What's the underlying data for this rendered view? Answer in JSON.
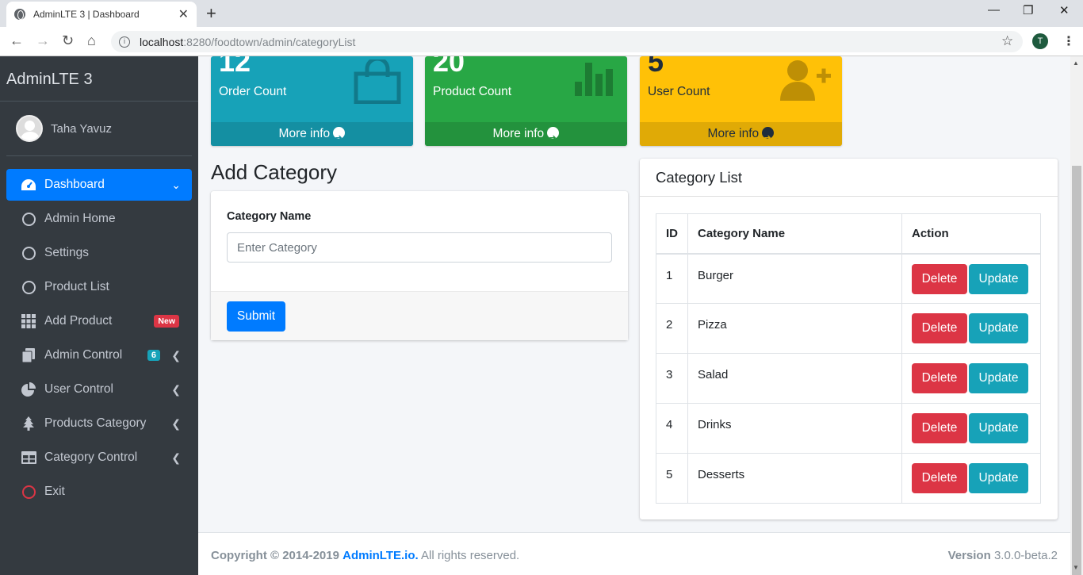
{
  "browser": {
    "tab_title": "AdminLTE 3 | Dashboard",
    "close": "✕",
    "new_tab": "+",
    "url_host": "localhost",
    "url_path": ":8280/foodtown/admin/categoryList",
    "profile_initial": "T",
    "win_min": "—",
    "win_max": "❐",
    "win_close": "✕"
  },
  "sidebar": {
    "brand": "AdminLTE 3",
    "user_name": "Taha Yavuz",
    "items": [
      {
        "label": "Dashboard",
        "icon": "tachometer-icon"
      },
      {
        "label": "Admin Home",
        "icon": "circle-icon"
      },
      {
        "label": "Settings",
        "icon": "circle-icon"
      },
      {
        "label": "Product List",
        "icon": "circle-icon"
      },
      {
        "label": "Add Product",
        "icon": "th-icon",
        "badge": "New"
      },
      {
        "label": "Admin Control",
        "icon": "copy-icon",
        "badge": "6"
      },
      {
        "label": "User Control",
        "icon": "chart-pie-icon"
      },
      {
        "label": "Products Category",
        "icon": "tree-icon"
      },
      {
        "label": "Category Control",
        "icon": "table-icon"
      },
      {
        "label": "Exit",
        "icon": "circle-red-icon"
      }
    ]
  },
  "stats": [
    {
      "value": "12",
      "label": "Order Count",
      "more": "More info",
      "color": "#17a2b8"
    },
    {
      "value": "20",
      "label": "Product Count",
      "more": "More info",
      "color": "#28a745"
    },
    {
      "value": "5",
      "label": "User Count",
      "more": "More info",
      "color": "#ffc107"
    }
  ],
  "add_category": {
    "heading": "Add Category",
    "field_label": "Category Name",
    "placeholder": "Enter Category",
    "submit": "Submit"
  },
  "category_list": {
    "title": "Category List",
    "columns": [
      "ID",
      "Category Name",
      "Action"
    ],
    "rows": [
      {
        "id": "1",
        "name": "Burger"
      },
      {
        "id": "2",
        "name": "Pizza"
      },
      {
        "id": "3",
        "name": "Salad"
      },
      {
        "id": "4",
        "name": "Drinks"
      },
      {
        "id": "5",
        "name": "Desserts"
      }
    ],
    "delete_label": "Delete",
    "update_label": "Update"
  },
  "footer": {
    "copyright": "Copyright © 2014-2019",
    "link": "AdminLTE.io.",
    "rights": "All rights reserved.",
    "version_label": "Version",
    "version": "3.0.0-beta.2"
  }
}
